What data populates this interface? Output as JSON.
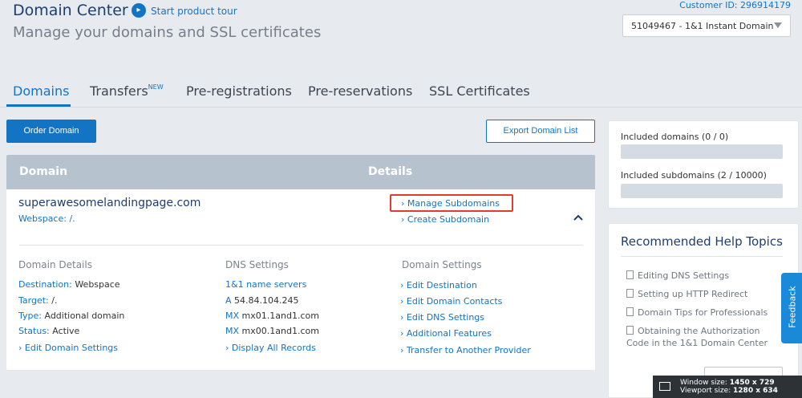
{
  "header": {
    "title": "Domain Center",
    "tour_link": "Start product tour",
    "subtitle": "Manage your domains and SSL certificates",
    "customer_id": "Customer ID: 296914179",
    "contract_selected": "51049467 - 1&1 Instant Domain"
  },
  "tabs": [
    {
      "label": "Domains",
      "active": true
    },
    {
      "label": "Transfers",
      "badge": "NEW"
    },
    {
      "label": "Pre-registrations"
    },
    {
      "label": "Pre-reservations"
    },
    {
      "label": "SSL Certificates"
    }
  ],
  "actions": {
    "order_domain": "Order Domain",
    "export_list": "Export Domain List"
  },
  "table": {
    "headers": [
      "Domain",
      "Details"
    ],
    "domain": {
      "name": "superawesomelandingpage.com",
      "webspace": "Webspace: /.",
      "details_links": [
        "Manage Subdomains",
        "Create Subdomain"
      ]
    },
    "domain_details": {
      "heading": "Domain Details",
      "rows": [
        {
          "label": "Destination:",
          "value": "Webspace"
        },
        {
          "label": "Target:",
          "value": "/."
        },
        {
          "label": "Type:",
          "value": "Additional domain"
        },
        {
          "label": "Status:",
          "value": "Active"
        }
      ],
      "edit_link": "Edit Domain Settings"
    },
    "dns_settings": {
      "heading": "DNS Settings",
      "name_servers": "1&1 name servers",
      "records": [
        {
          "type": "A",
          "value": "54.84.104.245"
        },
        {
          "type": "MX",
          "value": "mx01.1and1.com"
        },
        {
          "type": "MX",
          "value": "mx00.1and1.com"
        }
      ],
      "display_all": "Display All Records"
    },
    "domain_settings": {
      "heading": "Domain Settings",
      "links": [
        "Edit Destination",
        "Edit Domain Contacts",
        "Edit DNS Settings",
        "Additional Features",
        "Transfer to Another Provider"
      ]
    }
  },
  "sidebar": {
    "included_domains": "Included domains (0 / 0)",
    "included_subdomains": "Included subdomains (2 / 10000)",
    "help_title": "Recommended Help Topics",
    "help_items": [
      "Editing DNS Settings",
      "Setting up HTTP Redirect",
      "Domain Tips for Professionals",
      "Obtaining the Authorization Code in the 1&1 Domain Center"
    ]
  },
  "feedback": "Feedback",
  "window_badge": {
    "window_size_label": "Window size:",
    "window_size": "1450 x 729",
    "viewport_size_label": "Viewport size:",
    "viewport_size": "1280 x 634"
  }
}
